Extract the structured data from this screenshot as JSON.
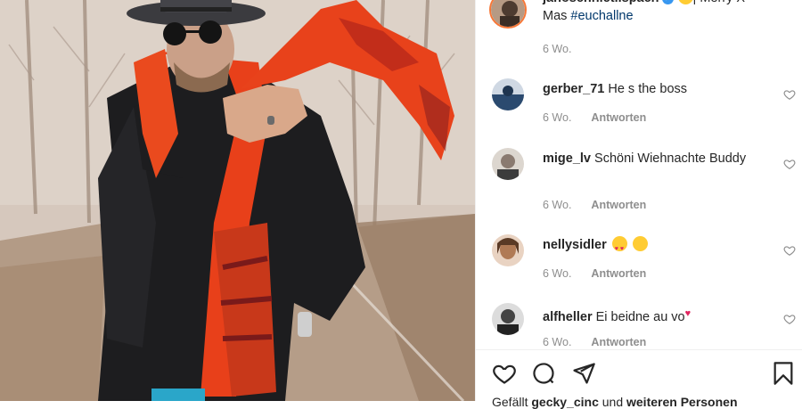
{
  "post": {
    "author": "janoschnietlispach",
    "caption": "| Merry X-Mas ",
    "hashtag": "#euchallne",
    "time": "6 Wo."
  },
  "comments": [
    {
      "user": "gerber_71",
      "text": "He s the boss",
      "time": "6 Wo.",
      "reply": "Antworten",
      "avatar": "#2b4a6f"
    },
    {
      "user": "mige_lv",
      "text": "Schöni Wiehnachte Buddy",
      "time": "6 Wo.",
      "reply": "Antworten",
      "avatar": "#8a7a70"
    },
    {
      "user": "nellysidler",
      "text": "",
      "time": "6 Wo.",
      "reply": "Antworten",
      "avatar": "#b07a55"
    },
    {
      "user": "alfheller",
      "text": "Ei beidne au vo",
      "time": "6 Wo.",
      "reply": "Antworten",
      "avatar": "#444"
    }
  ],
  "likes": {
    "prefix": "Gefällt ",
    "user": "gecky_cinc",
    "middle": " und ",
    "rest": "weiteren Personen"
  },
  "icons": [
    "heart-icon",
    "comment-icon",
    "share-icon",
    "bookmark-icon"
  ]
}
